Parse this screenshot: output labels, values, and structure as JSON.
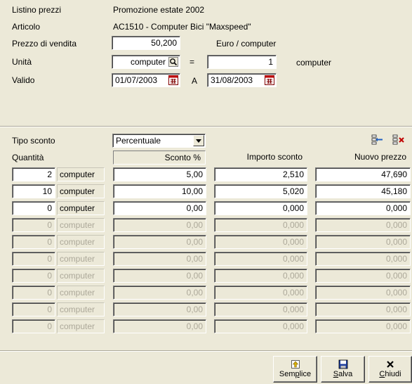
{
  "header": {
    "listino_label": "Listino prezzi",
    "listino_value": "Promozione estate 2002",
    "articolo_label": "Articolo",
    "articolo_value": "AC1510 - Computer Bici \"Maxspeed\"",
    "prezzo_label": "Prezzo di vendita",
    "prezzo_value": "50,200",
    "prezzo_unit": "Euro / computer",
    "unita_label": "Unità",
    "unita_value": "computer",
    "equals": "=",
    "conv_value": "1",
    "conv_unit": "computer",
    "valido_label": "Valido",
    "valido_from": "01/07/2003",
    "valido_a": "A",
    "valido_to": "31/08/2003"
  },
  "discount": {
    "tipo_label": "Tipo sconto",
    "tipo_value": "Percentuale",
    "col_quantita": "Quantità",
    "col_sconto": "Sconto %",
    "col_importo": "Importo sconto",
    "col_nuovo": "Nuovo prezzo",
    "rows": [
      {
        "qty": "2",
        "unit": "computer",
        "sconto": "5,00",
        "importo": "2,510",
        "nuovo": "47,690",
        "enabled": true
      },
      {
        "qty": "10",
        "unit": "computer",
        "sconto": "10,00",
        "importo": "5,020",
        "nuovo": "45,180",
        "enabled": true
      },
      {
        "qty": "0",
        "unit": "computer",
        "sconto": "0,00",
        "importo": "0,000",
        "nuovo": "0,000",
        "enabled": true
      },
      {
        "qty": "0",
        "unit": "computer",
        "sconto": "0,00",
        "importo": "0,000",
        "nuovo": "0,000",
        "enabled": false
      },
      {
        "qty": "0",
        "unit": "computer",
        "sconto": "0,00",
        "importo": "0,000",
        "nuovo": "0,000",
        "enabled": false
      },
      {
        "qty": "0",
        "unit": "computer",
        "sconto": "0,00",
        "importo": "0,000",
        "nuovo": "0,000",
        "enabled": false
      },
      {
        "qty": "0",
        "unit": "computer",
        "sconto": "0,00",
        "importo": "0,000",
        "nuovo": "0,000",
        "enabled": false
      },
      {
        "qty": "0",
        "unit": "computer",
        "sconto": "0,00",
        "importo": "0,000",
        "nuovo": "0,000",
        "enabled": false
      },
      {
        "qty": "0",
        "unit": "computer",
        "sconto": "0,00",
        "importo": "0,000",
        "nuovo": "0,000",
        "enabled": false
      },
      {
        "qty": "0",
        "unit": "computer",
        "sconto": "0,00",
        "importo": "0,000",
        "nuovo": "0,000",
        "enabled": false
      }
    ]
  },
  "buttons": {
    "semplice": "Semplice",
    "salva": "Salva",
    "chiudi": "Chiudi"
  },
  "icons": {
    "insert_row": "insert-row-icon",
    "delete_row": "delete-row-icon",
    "lookup": "lookup-icon",
    "calendar": "calendar-icon"
  }
}
